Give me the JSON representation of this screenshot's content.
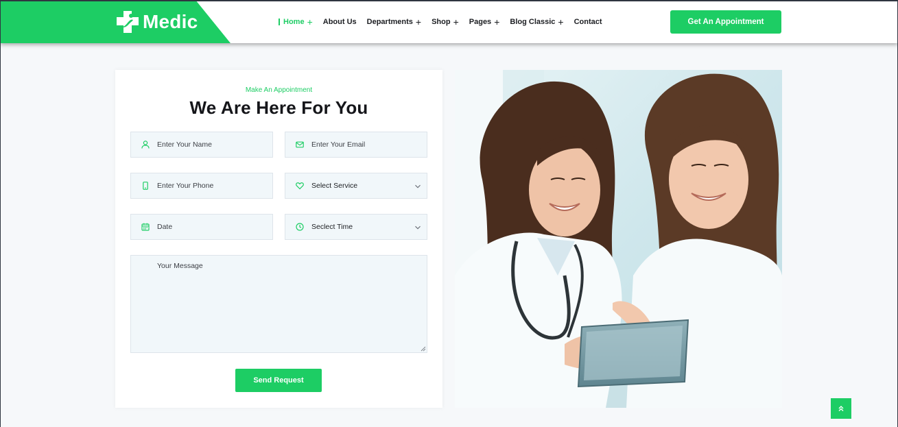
{
  "brand": {
    "name": "Medic",
    "accent": "#1dcd64"
  },
  "nav": {
    "items": [
      {
        "label": "Home",
        "active": true,
        "has_submenu": true
      },
      {
        "label": "About Us",
        "active": false,
        "has_submenu": false
      },
      {
        "label": "Departments",
        "active": false,
        "has_submenu": true
      },
      {
        "label": "Shop",
        "active": false,
        "has_submenu": true
      },
      {
        "label": "Pages",
        "active": false,
        "has_submenu": true
      },
      {
        "label": "Blog Classic",
        "active": false,
        "has_submenu": true
      },
      {
        "label": "Contact",
        "active": false,
        "has_submenu": false
      }
    ],
    "cta_label": "Get An Appointment"
  },
  "form": {
    "subtitle": "Make An Appointment",
    "title": "We Are Here For You",
    "name_placeholder": "Enter Your Name",
    "email_placeholder": "Enter Your Email",
    "phone_placeholder": "Enter Your Phone",
    "service_selected": "Select Service",
    "date_placeholder": "Date",
    "time_selected": "Seclect Time",
    "message_placeholder": "Your Message",
    "submit_label": "Send Request"
  },
  "icons": {
    "name": "user-icon",
    "email": "envelope-icon",
    "phone": "mobile-icon",
    "service": "heart-icon",
    "date": "calendar-icon",
    "time": "clock-icon",
    "scroll_top": "double-chevron-up-icon"
  }
}
